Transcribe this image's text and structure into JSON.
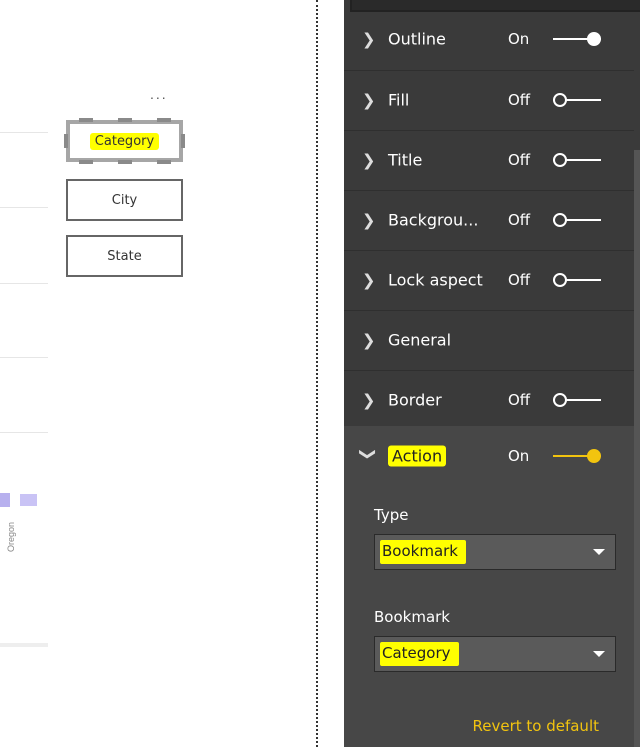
{
  "canvas": {
    "more_glyph": "...",
    "buttons": [
      {
        "label": "Category",
        "selected": true
      },
      {
        "label": "City",
        "selected": false
      },
      {
        "label": "State",
        "selected": false
      }
    ],
    "axis_label": "Oregon"
  },
  "format_pane": {
    "rows": [
      {
        "label": "Outline",
        "state": "On"
      },
      {
        "label": "Fill",
        "state": "Off"
      },
      {
        "label": "Title",
        "state": "Off"
      },
      {
        "label": "Backgrou...",
        "state": "Off"
      },
      {
        "label": "Lock aspect",
        "state": "Off"
      },
      {
        "label": "General",
        "state": ""
      },
      {
        "label": "Border",
        "state": "Off"
      }
    ],
    "action": {
      "label": "Action",
      "state": "On",
      "type_label": "Type",
      "type_value": "Bookmark",
      "bookmark_label": "Bookmark",
      "bookmark_value": "Category",
      "revert": "Revert to default"
    }
  },
  "colors": {
    "pane_bg": "#3a3a3a",
    "accent": "#f2c40f",
    "highlight": "#ffff00"
  }
}
